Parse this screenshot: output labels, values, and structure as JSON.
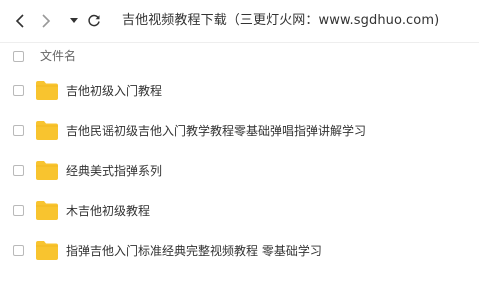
{
  "toolbar": {
    "back_icon": "chevron-left-icon",
    "forward_icon": "chevron-right-icon",
    "dropdown_icon": "caret-down-icon",
    "refresh_icon": "refresh-icon",
    "path": "吉他视频教程下载（三更灯火网：www.sgdhuo.com)"
  },
  "list_header": {
    "column_name": "文件名"
  },
  "files": [
    {
      "name": "吉他初级入门教程",
      "type": "folder"
    },
    {
      "name": "吉他民谣初级吉他入门教学教程零基础弹唱指弹讲解学习",
      "type": "folder"
    },
    {
      "name": "经典美式指弹系列",
      "type": "folder"
    },
    {
      "name": "木吉他初级教程",
      "type": "folder"
    },
    {
      "name": "指弹吉他入门标准经典完整视频教程 零基础学习",
      "type": "folder"
    }
  ],
  "colors": {
    "folder": "#f8c42f",
    "text": "#333333",
    "muted": "#666666"
  }
}
